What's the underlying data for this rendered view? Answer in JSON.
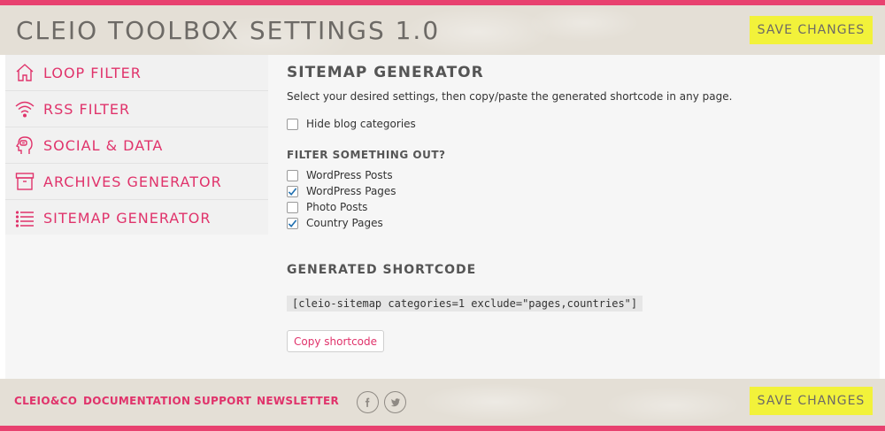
{
  "app": {
    "title": "CLEIO TOOLBOX SETTINGS 1.0",
    "save_label": "SAVE CHANGES"
  },
  "colors": {
    "accent": "#e0336b",
    "stripe": "#e8416f",
    "save_button": "#f2f23a",
    "header_bg": "#e4dfd6"
  },
  "sidebar": {
    "items": [
      {
        "label": "LOOP FILTER",
        "icon": "home-icon"
      },
      {
        "label": "RSS FILTER",
        "icon": "wifi-icon"
      },
      {
        "label": "SOCIAL & DATA",
        "icon": "head-chat-icon"
      },
      {
        "label": "ARCHIVES GENERATOR",
        "icon": "archive-box-icon"
      },
      {
        "label": "SITEMAP GENERATOR",
        "icon": "list-icon"
      }
    ]
  },
  "main": {
    "title": "SITEMAP GENERATOR",
    "description": "Select your desired settings, then copy/paste the generated shortcode in any page.",
    "hide_categories": {
      "label": "Hide blog categories",
      "checked": false
    },
    "filter_heading": "FILTER SOMETHING OUT?",
    "filters": [
      {
        "label": "WordPress Posts",
        "checked": false
      },
      {
        "label": "WordPress Pages",
        "checked": true
      },
      {
        "label": "Photo Posts",
        "checked": false
      },
      {
        "label": "Country Pages",
        "checked": true
      }
    ],
    "generated_heading": "GENERATED SHORTCODE",
    "shortcode": "[cleio-sitemap categories=1 exclude=\"pages,countries\"]",
    "copy_label": "Copy shortcode"
  },
  "footer": {
    "links": [
      "CLEIO&CO",
      "DOCUMENTATION",
      "SUPPORT",
      "NEWSLETTER"
    ],
    "social": [
      "facebook-icon",
      "twitter-icon"
    ]
  }
}
